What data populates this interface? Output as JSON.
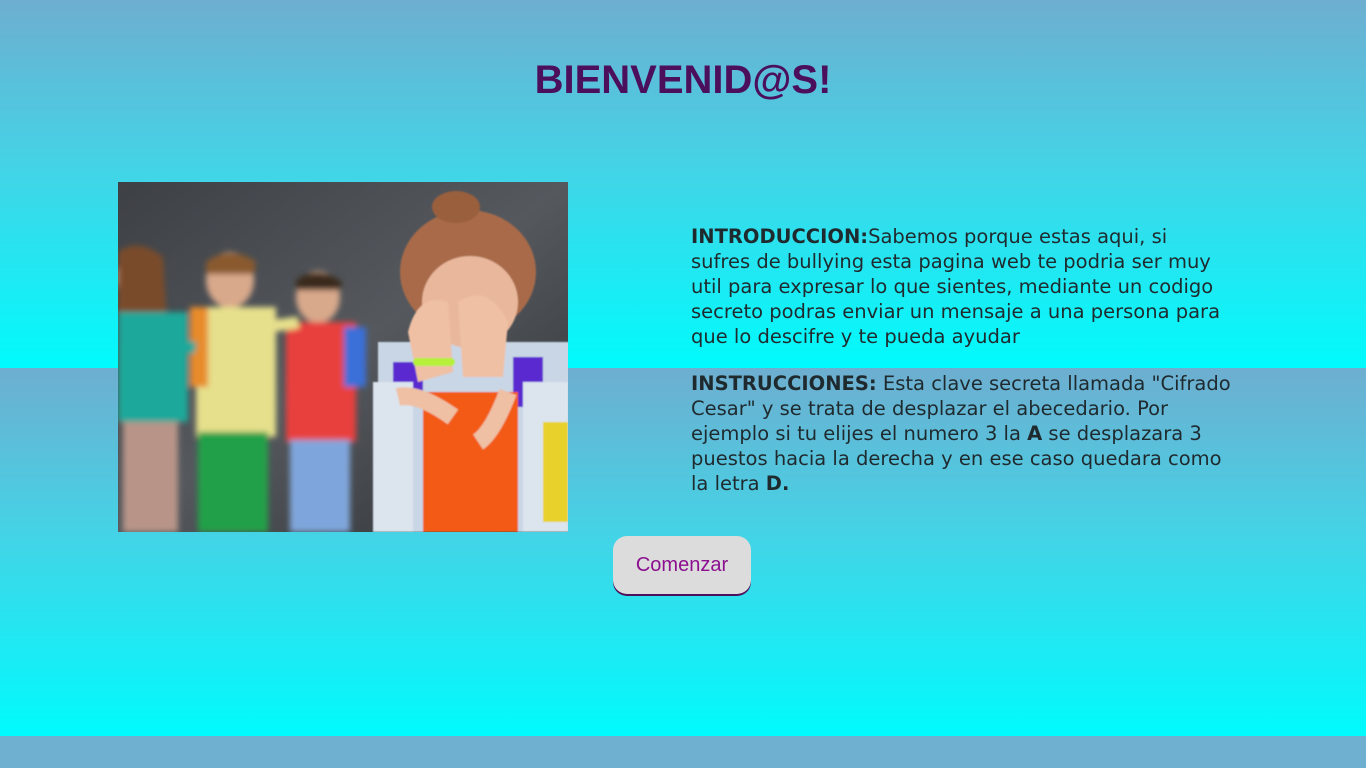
{
  "header": {
    "title": "BIENVENID@S!"
  },
  "intro": {
    "heading": "INTRODUCCION:",
    "body": "Sabemos porque estas aqui, si sufres de bullying esta pagina web te podria ser muy util para expresar lo que sientes, mediante un codigo secreto podras enviar un mensaje a una persona para que lo descifre y te pueda ayudar"
  },
  "instructions": {
    "heading": "INSTRUCCIONES:",
    "part1": " Esta clave secreta llamada \"Cifrado Cesar\" y se trata de desplazar el abecedario. Por ejemplo si tu elijes el numero 3 la ",
    "letter_a": "A",
    "part2": " se desplazara 3 puestos hacia la derecha y en ese caso quedara como la letra ",
    "letter_d": "D."
  },
  "button": {
    "label": "Comenzar"
  },
  "colors": {
    "title": "#4b0f5c",
    "button_text": "#8b0f8f",
    "button_bg": "#dcdcdc",
    "gradient_top": "#6eaed0",
    "gradient_bottom": "#00fbfd"
  },
  "image": {
    "icon": "photo-children-bullying"
  }
}
